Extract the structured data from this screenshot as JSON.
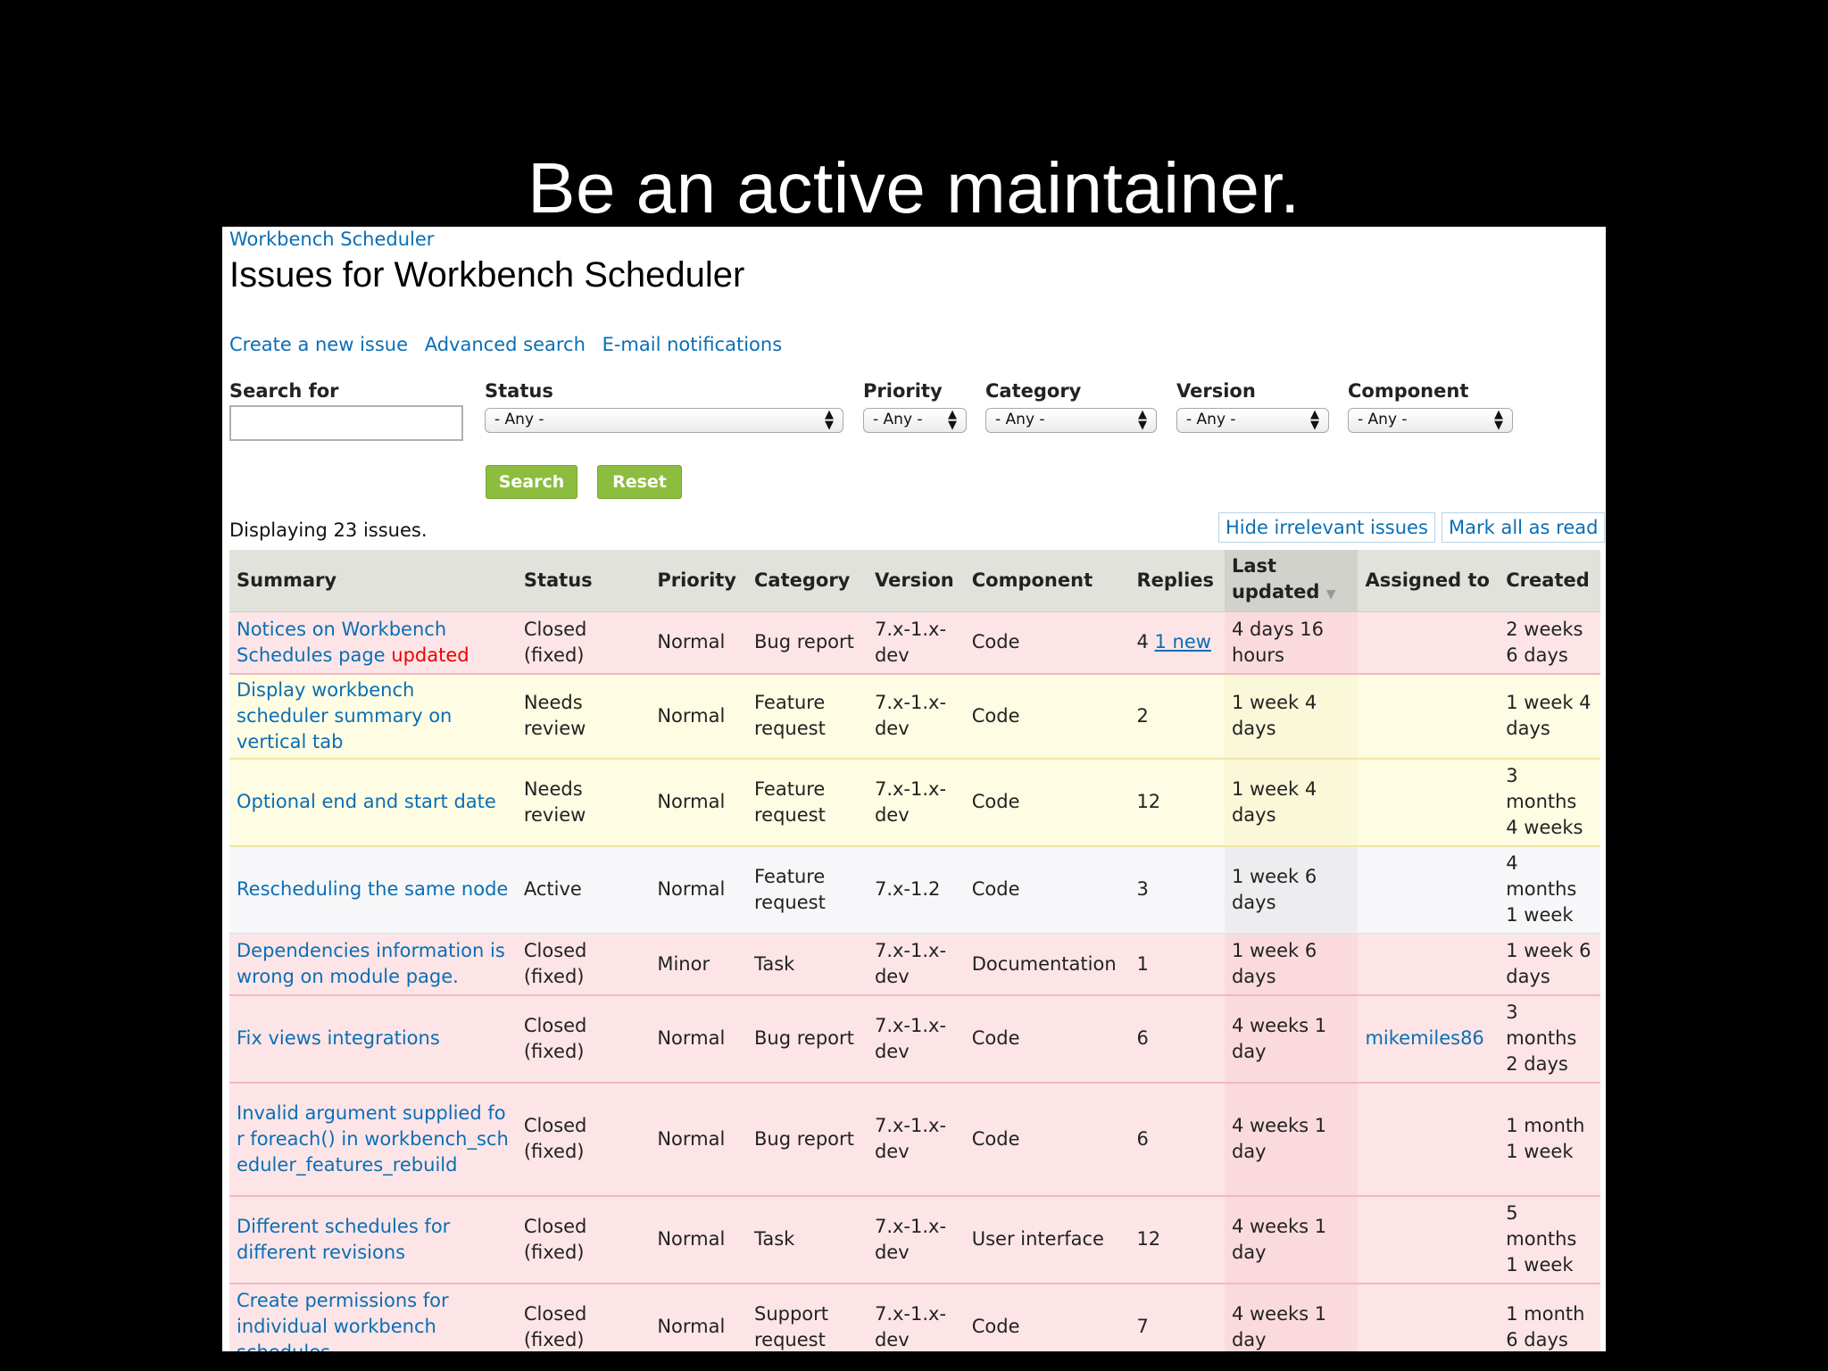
{
  "slide": {
    "title": "Be an active maintainer."
  },
  "breadcrumb": "Workbench Scheduler",
  "page_title": "Issues for Workbench Scheduler",
  "links": [
    "Create a new issue",
    "Advanced search",
    "E-mail notifications"
  ],
  "filters": {
    "search_label": "Search for",
    "search_value": "",
    "status": {
      "label": "Status",
      "value": "- Any -"
    },
    "priority": {
      "label": "Priority",
      "value": "- Any -"
    },
    "category": {
      "label": "Category",
      "value": "- Any -"
    },
    "version": {
      "label": "Version",
      "value": "- Any -"
    },
    "component": {
      "label": "Component",
      "value": "- Any -"
    }
  },
  "buttons": {
    "search": "Search",
    "reset": "Reset",
    "hide_irrelevant": "Hide irrelevant issues",
    "mark_all_read": "Mark all as read"
  },
  "displaying": "Displaying 23 issues.",
  "table": {
    "columns": [
      "Summary",
      "Status",
      "Priority",
      "Category",
      "Version",
      "Component",
      "Replies",
      "Last updated",
      "Assigned to",
      "Created"
    ],
    "rows": [
      {
        "summary": "Notices on Workbench Schedules page",
        "summary_flag": "updated",
        "status": "Closed (fixed)",
        "priority": "Normal",
        "category": "Bug report",
        "version": "7.x-1.x-dev",
        "component": "Code",
        "replies": "4",
        "replies_new": "1 new",
        "last_updated": "4 days 16 hours",
        "assigned_to": "",
        "created": "2 weeks 6 days"
      },
      {
        "summary": "Display workbench scheduler summary on vertical tab",
        "status": "Needs review",
        "priority": "Normal",
        "category": "Feature request",
        "version": "7.x-1.x-dev",
        "component": "Code",
        "replies": "2",
        "last_updated": "1 week 4 days",
        "assigned_to": "",
        "created": "1 week 4 days"
      },
      {
        "summary": "Optional end and start date",
        "status": "Needs review",
        "priority": "Normal",
        "category": "Feature request",
        "version": "7.x-1.x-dev",
        "component": "Code",
        "replies": "12",
        "last_updated": "1 week 4 days",
        "assigned_to": "",
        "created": "3 months 4 weeks"
      },
      {
        "summary": "Rescheduling the same node",
        "status": "Active",
        "priority": "Normal",
        "category": "Feature request",
        "version": "7.x-1.2",
        "component": "Code",
        "replies": "3",
        "last_updated": "1 week 6 days",
        "assigned_to": "",
        "created": "4 months 1 week"
      },
      {
        "summary": "Dependencies information is wrong on module page.",
        "status": "Closed (fixed)",
        "priority": "Minor",
        "category": "Task",
        "version": "7.x-1.x-dev",
        "component": "Documentation",
        "replies": "1",
        "last_updated": "1 week 6 days",
        "assigned_to": "",
        "created": "1 week 6 days"
      },
      {
        "summary": "Fix views integrations",
        "status": "Closed (fixed)",
        "priority": "Normal",
        "category": "Bug report",
        "version": "7.x-1.x-dev",
        "component": "Code",
        "replies": "6",
        "last_updated": "4 weeks 1 day",
        "assigned_to": "mikemiles86",
        "created": "3 months 2 days"
      },
      {
        "summary": "Invalid argument supplied for foreach() in workbench_scheduler_features_rebuild",
        "status": "Closed (fixed)",
        "priority": "Normal",
        "category": "Bug report",
        "version": "7.x-1.x-dev",
        "component": "Code",
        "replies": "6",
        "last_updated": "4 weeks 1 day",
        "assigned_to": "",
        "created": "1 month 1 week"
      },
      {
        "summary": "Different schedules for different revisions",
        "status": "Closed (fixed)",
        "priority": "Normal",
        "category": "Task",
        "version": "7.x-1.x-dev",
        "component": "User interface",
        "replies": "12",
        "last_updated": "4 weeks 1 day",
        "assigned_to": "",
        "created": "5 months 1 week"
      },
      {
        "summary": "Create permissions for individual workbench schedules",
        "status": "Closed (fixed)",
        "priority": "Normal",
        "category": "Support request",
        "version": "7.x-1.x-dev",
        "component": "Code",
        "replies": "7",
        "last_updated": "4 weeks 1 day",
        "assigned_to": "",
        "created": "1 month 6 days"
      }
    ]
  }
}
